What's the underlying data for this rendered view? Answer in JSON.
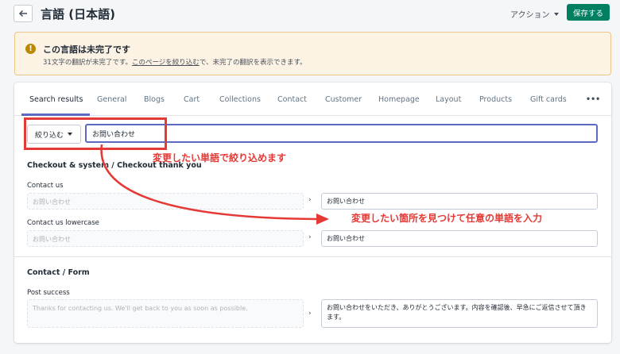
{
  "header": {
    "title": "言語 (日本語)",
    "actions_label": "アクション",
    "save_label": "保存する"
  },
  "banner": {
    "title": "この言語は未完了です",
    "text_before": "31文字の翻訳が未完了です。",
    "link": "このページを絞り込む",
    "text_after": "で、未完了の翻訳を表示できます。"
  },
  "tabs": [
    "Search results",
    "General",
    "Blogs",
    "Cart",
    "Collections",
    "Contact",
    "Customer",
    "Homepage",
    "Layout",
    "Products",
    "Gift cards",
    "•••"
  ],
  "filter": {
    "button_label": "絞り込む",
    "search_value": "お問い合わせ"
  },
  "sections": [
    {
      "title": "Checkout & system / Checkout thank you",
      "fields": [
        {
          "label": "Contact us",
          "source": "お問い合わせ",
          "target": "お問い合わせ"
        },
        {
          "label": "Contact us lowercase",
          "source": "お問い合わせ",
          "target": "お問い合わせ"
        }
      ]
    },
    {
      "title": "Contact / Form",
      "fields": [
        {
          "label": "Post success",
          "source": "Thanks for contacting us. We'll get back to you as soon as possible.",
          "target": "お問い合わせをいただき、ありがとうございます。内容を確認後、早急にご返信させて頂きます。"
        }
      ]
    }
  ],
  "annotations": {
    "filter_note": "変更したい単語で絞り込めます",
    "edit_note": "変更したい箇所を見つけて任意の単語を入力"
  },
  "colors": {
    "accent": "#5c6ac4",
    "save": "#008060",
    "annotation": "#e53935",
    "banner_bg": "#fdf3e4"
  }
}
